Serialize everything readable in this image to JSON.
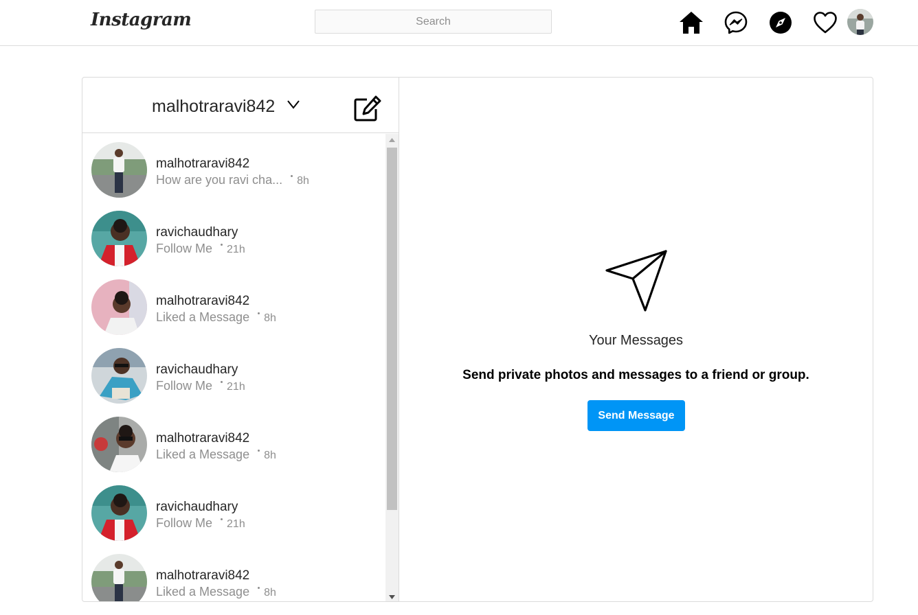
{
  "topnav": {
    "logo_text": "Instagram",
    "search_placeholder": "Search",
    "icons": [
      "home-icon",
      "messenger-icon",
      "explore-compass-icon",
      "activity-heart-icon"
    ]
  },
  "inbox": {
    "account_name": "malhotraravi842",
    "threads": [
      {
        "name": "malhotraravi842",
        "snippet": "How are you ravi cha...",
        "time": "8h"
      },
      {
        "name": "ravichaudhary",
        "snippet": "Follow Me",
        "time": "21h"
      },
      {
        "name": "malhotraravi842",
        "snippet": "Liked a Message",
        "time": "8h"
      },
      {
        "name": "ravichaudhary",
        "snippet": "Follow Me",
        "time": "21h"
      },
      {
        "name": "malhotraravi842",
        "snippet": "Liked a Message",
        "time": "8h"
      },
      {
        "name": "ravichaudhary",
        "snippet": "Follow Me",
        "time": "21h"
      },
      {
        "name": "malhotraravi842",
        "snippet": "Liked a Message",
        "time": "8h"
      }
    ]
  },
  "empty_state": {
    "title": "Your Messages",
    "subtitle": "Send private photos and messages to a friend or group.",
    "button_label": "Send Message"
  },
  "colors": {
    "accent": "#0095f6",
    "border": "#dbdbdb",
    "muted_text": "#8e8e8e"
  }
}
